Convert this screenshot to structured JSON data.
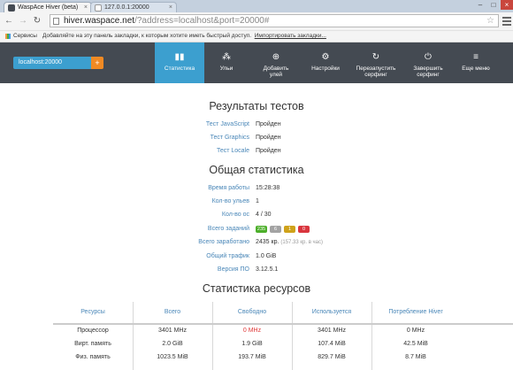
{
  "browser": {
    "tabs": [
      {
        "title": "WaspAce Hiver (beta)",
        "active": true
      },
      {
        "title": "127.0.0.1:20000",
        "active": false
      }
    ],
    "window_controls": [
      "–",
      "□",
      "×"
    ],
    "url_host": "hiver.waspace.net",
    "url_rest": "/?address=localhost&port=20000#",
    "bookmarks": {
      "apps_label": "Сервисы",
      "hint": "Добавляйте на эту панель закладки, к которым хотите иметь быстрый доступ.",
      "import_link": "Импортировать закладки..."
    }
  },
  "appbar": {
    "host": "localhost:20000",
    "add_label": "+",
    "nav": [
      {
        "label": "Статистика",
        "icon": "bar-chart-icon",
        "glyph": "▮▮",
        "active": true
      },
      {
        "label": "Ульи",
        "icon": "hives-icon",
        "glyph": "⁂",
        "active": false
      },
      {
        "label": "Добавить\nулей",
        "icon": "add-hive-icon",
        "glyph": "⊕",
        "active": false
      },
      {
        "label": "Настройки",
        "icon": "gear-icon",
        "glyph": "⚙",
        "active": false
      },
      {
        "label": "Перезапустить\nсерфинг",
        "icon": "restart-icon",
        "glyph": "↻",
        "active": false
      },
      {
        "label": "Завершить\nсерфинг",
        "icon": "power-icon",
        "glyph": "⏻",
        "active": false
      },
      {
        "label": "Еще меню",
        "icon": "menu-icon",
        "glyph": "≡",
        "active": false
      }
    ]
  },
  "tests": {
    "title": "Результаты тестов",
    "rows": [
      {
        "label": "Тест JavaScript",
        "value": "Пройден"
      },
      {
        "label": "Тест Graphics",
        "value": "Пройден"
      },
      {
        "label": "Тест Locale",
        "value": "Пройден"
      }
    ]
  },
  "stats": {
    "title": "Общая статистика",
    "uptime_label": "Время работы",
    "uptime": "15:28:38",
    "hives_label": "Кол-во ульев",
    "hives": "1",
    "os_label": "Кол-во ос",
    "os": "4 / 30",
    "tasks_label": "Всего заданий",
    "tasks": [
      {
        "value": "235",
        "color": "#4caf2a"
      },
      {
        "value": "6",
        "color": "#a3a3a3"
      },
      {
        "value": "1",
        "color": "#cfa21a"
      },
      {
        "value": "0",
        "color": "#d9363e"
      }
    ],
    "earned_label": "Всего заработано",
    "earned": "2435 кр.",
    "earned_rate": "(157.33 кр. в час)",
    "traffic_label": "Общий трафик",
    "traffic": "1.0 GiB",
    "version_label": "Версия ПО",
    "version": "3.12.5.1"
  },
  "resources": {
    "title": "Статистика ресурсов",
    "headers": [
      "Ресурсы",
      "Всего",
      "Свободно",
      "Используется",
      "Потребление Hiver"
    ],
    "rows": [
      {
        "name": "Процессор",
        "total": "3401 MHz",
        "free": "0 MHz",
        "used": "3401 MHz",
        "hiver": "0 MHz"
      },
      {
        "name": "Вирт. память",
        "total": "2.0 GiB",
        "free": "1.9 GiB",
        "used": "107.4 MiB",
        "hiver": "42.5 MiB"
      },
      {
        "name": "Физ. память",
        "total": "1023.5 MiB",
        "free": "193.7 MiB",
        "used": "829.7 MiB",
        "hiver": "8.7 MiB"
      }
    ],
    "free_alert_color": "#e03a3a"
  }
}
